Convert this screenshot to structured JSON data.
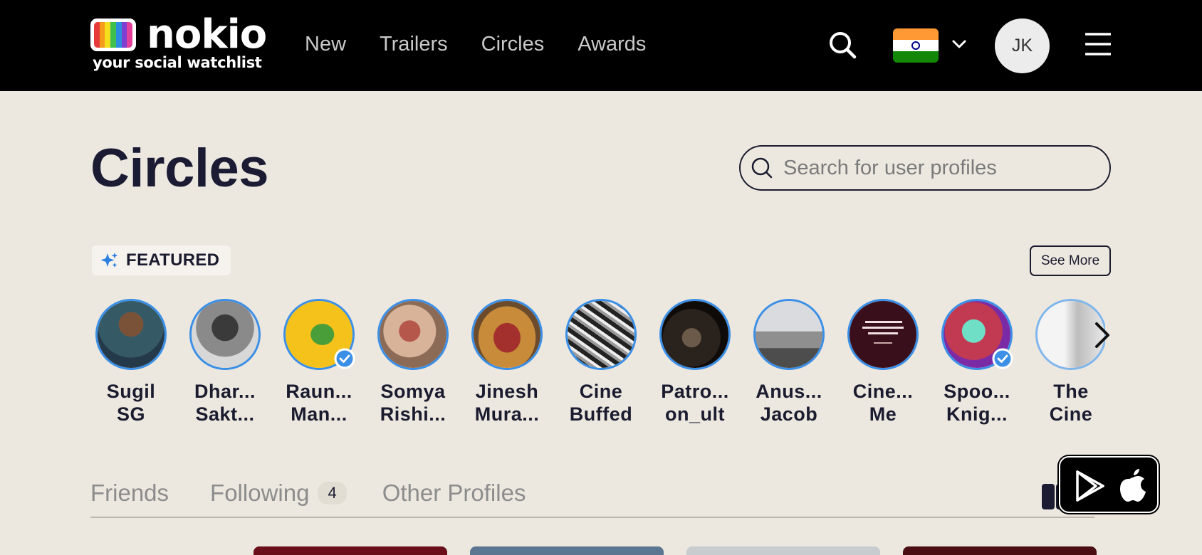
{
  "header": {
    "logo_word": "nokio",
    "logo_tagline": "your social watchlist",
    "nav": [
      "New",
      "Trailers",
      "Circles",
      "Awards"
    ],
    "avatar_initials": "JK",
    "country_flag_icon": "india-flag-icon"
  },
  "main": {
    "title": "Circles",
    "search_placeholder": "Search for user profiles",
    "featured_label": "FEATURED",
    "see_more_label": "See More",
    "profiles": [
      {
        "line1": "Sugil",
        "line2": "SG",
        "verified": false
      },
      {
        "line1": "Dhar...",
        "line2": "Sakt...",
        "verified": false
      },
      {
        "line1": "Raun...",
        "line2": "Man...",
        "verified": true
      },
      {
        "line1": "Somya",
        "line2": "Rishi...",
        "verified": false
      },
      {
        "line1": "Jinesh",
        "line2": "Mura...",
        "verified": false
      },
      {
        "line1": "Cine",
        "line2": "Buffed",
        "verified": false
      },
      {
        "line1": "Patro...",
        "line2": "on_ult",
        "verified": false
      },
      {
        "line1": "Anus...",
        "line2": "Jacob",
        "verified": false
      },
      {
        "line1": "Cine...",
        "line2": "Me",
        "verified": false
      },
      {
        "line1": "Spoo...",
        "line2": "Knig...",
        "verified": true
      },
      {
        "line1": "The",
        "line2": "Cine",
        "verified": false
      }
    ],
    "tabs": [
      {
        "label": "Friends"
      },
      {
        "label": "Following",
        "count": "4"
      },
      {
        "label": "Other Profiles"
      }
    ]
  },
  "colors": {
    "header_bg": "#000000",
    "page_bg": "#ece8e0",
    "accent_ring": "#3b8fe6",
    "text_dark": "#1b1b2f"
  }
}
